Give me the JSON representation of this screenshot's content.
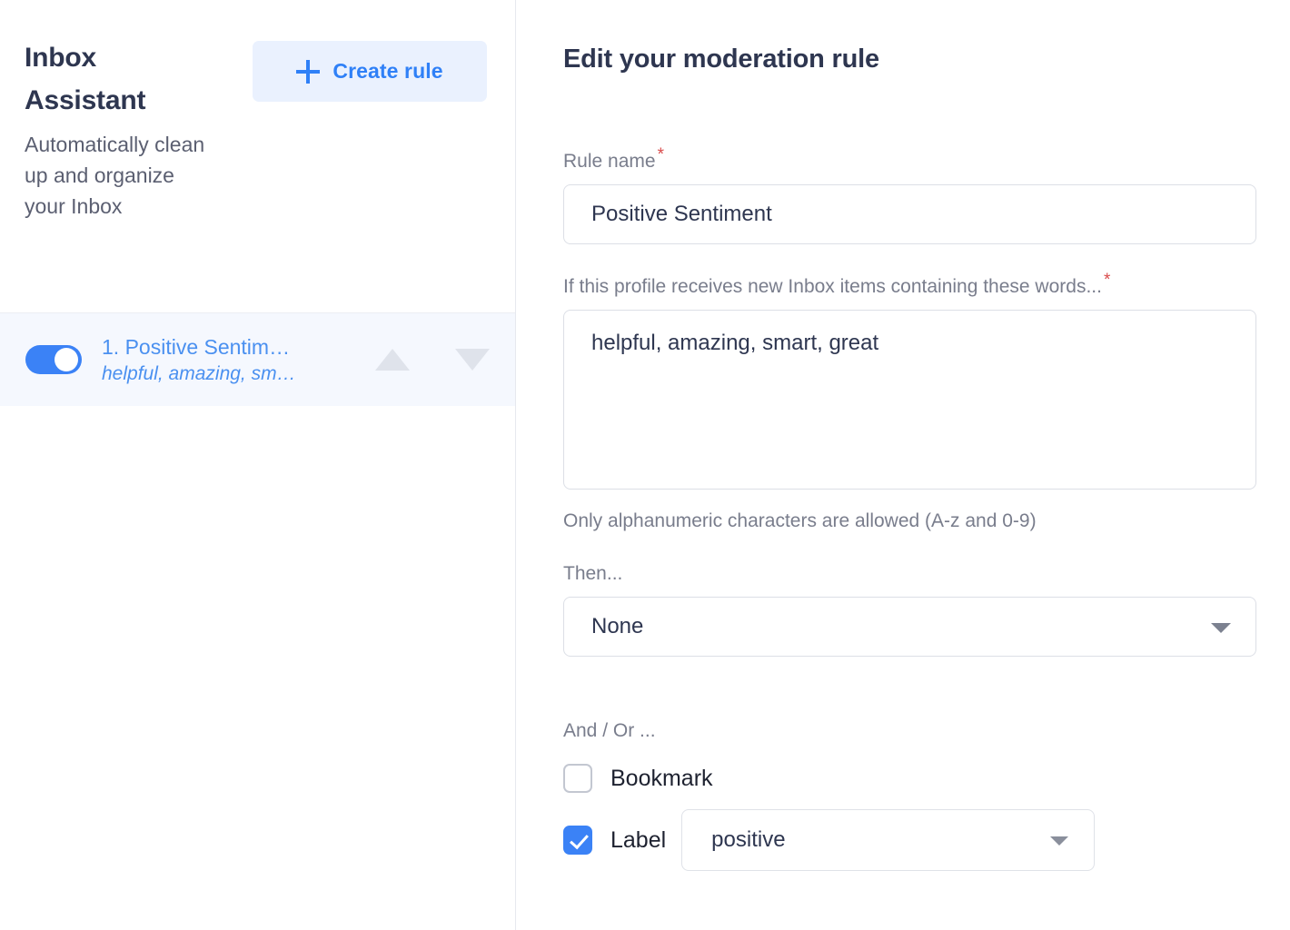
{
  "sidebar": {
    "brand_title": "Inbox Assistant",
    "brand_description": "Automatically clean up and organize your Inbox",
    "create_rule_label": "Create rule",
    "plus_icon": "plus-icon",
    "rules": [
      {
        "name": "1. Positive Sentim…",
        "words": "helpful, amazing, sm…",
        "enabled": true,
        "move_up_icon": "triangle-up-icon",
        "move_down_icon": "triangle-down-icon"
      }
    ]
  },
  "main": {
    "title": "Edit your moderation rule",
    "rule_name": {
      "label": "Rule name",
      "required_marker": "*",
      "value": "Positive Sentiment",
      "placeholder": "Rule name"
    },
    "words": {
      "label": "If this profile receives new Inbox items containing these words...",
      "required_marker": "*",
      "value": "helpful, amazing, smart, great",
      "placeholder": "",
      "hint": "Only alphanumeric characters are allowed (A-z and 0-9)"
    },
    "then": {
      "label": "Then...",
      "selected": "None",
      "caret_icon": "chevron-down-icon"
    },
    "and_or": {
      "label": "And / Or ...",
      "bookmark": {
        "label": "Bookmark",
        "checked": false
      },
      "label_option": {
        "label": "Label",
        "checked": true,
        "selected": "positive",
        "caret_icon": "chevron-down-icon"
      }
    }
  },
  "colors": {
    "accent_blue": "#3b82f6",
    "link_blue": "#4a90f0",
    "button_bg": "#eaf1fe",
    "heading": "#2e3650",
    "muted_text": "#797d8c",
    "required_red": "#d94c4c",
    "row_highlight": "#f5f8fe"
  }
}
